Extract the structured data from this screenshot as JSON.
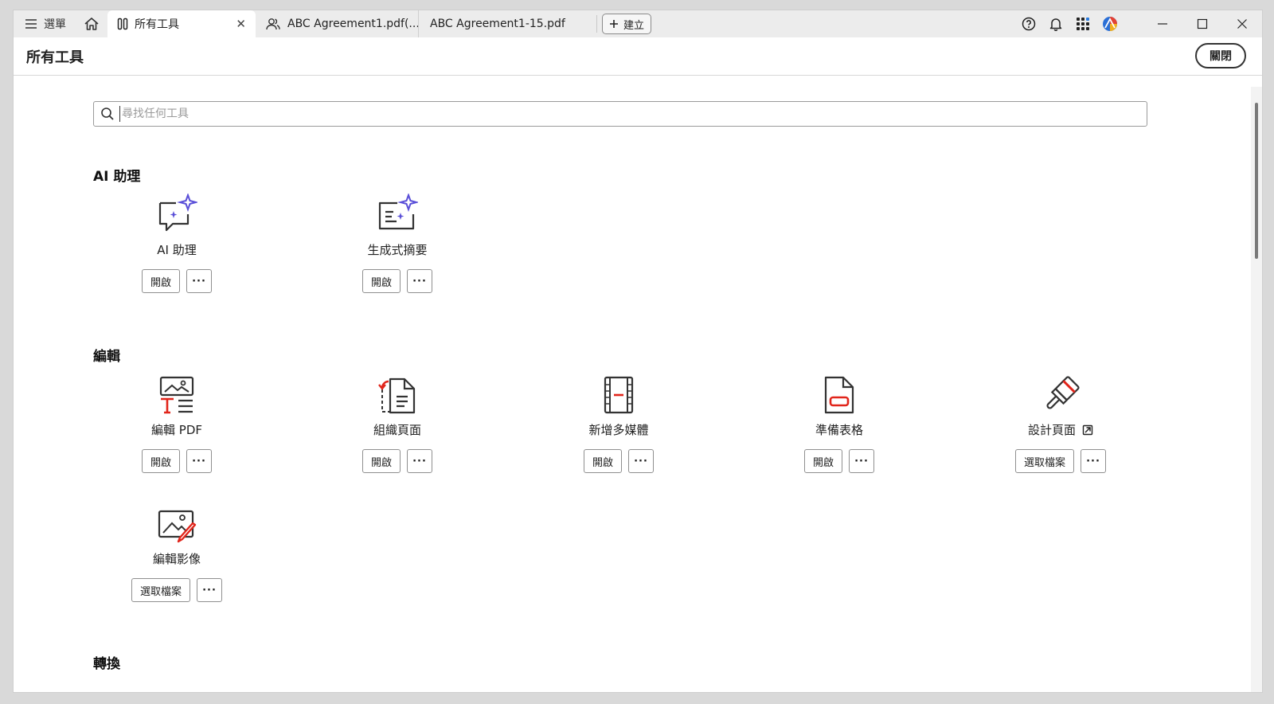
{
  "tabbar": {
    "menu_label": "選單",
    "tabs": [
      {
        "label": "所有工具",
        "icon": "tools-icon"
      },
      {
        "label": "ABC Agreement1.pdf(...",
        "icon": "shared-users-icon"
      },
      {
        "label": "ABC Agreement1-15.pdf"
      }
    ],
    "create_label": "建立"
  },
  "header": {
    "title": "所有工具",
    "close_label": "關閉"
  },
  "search": {
    "placeholder": "尋找任何工具"
  },
  "sections": {
    "ai": {
      "title": "AI 助理",
      "tools": [
        {
          "name": "AI 助理",
          "primary": "開啟",
          "more": "···"
        },
        {
          "name": "生成式摘要",
          "primary": "開啟",
          "more": "···"
        }
      ]
    },
    "edit": {
      "title": "編輯",
      "tools": [
        {
          "name": "編輯 PDF",
          "primary": "開啟",
          "more": "···"
        },
        {
          "name": "組織頁面",
          "primary": "開啟",
          "more": "···"
        },
        {
          "name": "新增多媒體",
          "primary": "開啟",
          "more": "···"
        },
        {
          "name": "準備表格",
          "primary": "開啟",
          "more": "···"
        },
        {
          "name": "設計頁面",
          "primary": "選取檔案",
          "more": "···"
        },
        {
          "name": "編輯影像",
          "primary": "選取檔案",
          "more": "···"
        }
      ]
    },
    "convert": {
      "title": "轉換"
    }
  },
  "colors": {
    "accent_red": "#e1251b",
    "ai_purple": "#5a4fd8"
  }
}
